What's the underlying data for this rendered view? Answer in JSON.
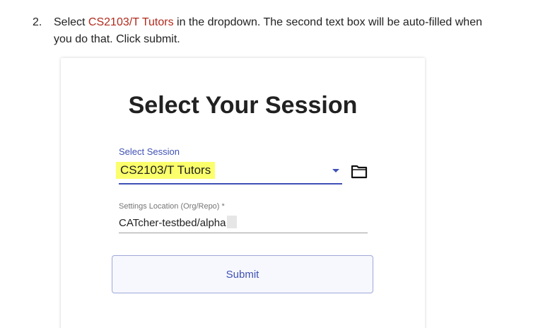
{
  "instruction": {
    "step_number": "2.",
    "before_highlight": "Select ",
    "highlight": "CS2103/T Tutors",
    "after_highlight": " in the dropdown. The second text box will be auto-filled when",
    "line2": "you do that. Click submit.",
    "highlight_color": "#b12a1c"
  },
  "card": {
    "title": "Select Your Session",
    "session_select": {
      "label": "Select Session",
      "value": "CS2103/T Tutors",
      "highlight_color": "#fbff6b",
      "accent_color": "#3f51b5"
    },
    "folder_icon": "folder-open-icon",
    "settings_location": {
      "label": "Settings Location (Org/Repo) *",
      "value": "CATcher-testbed/alpha"
    },
    "submit_label": "Submit"
  }
}
